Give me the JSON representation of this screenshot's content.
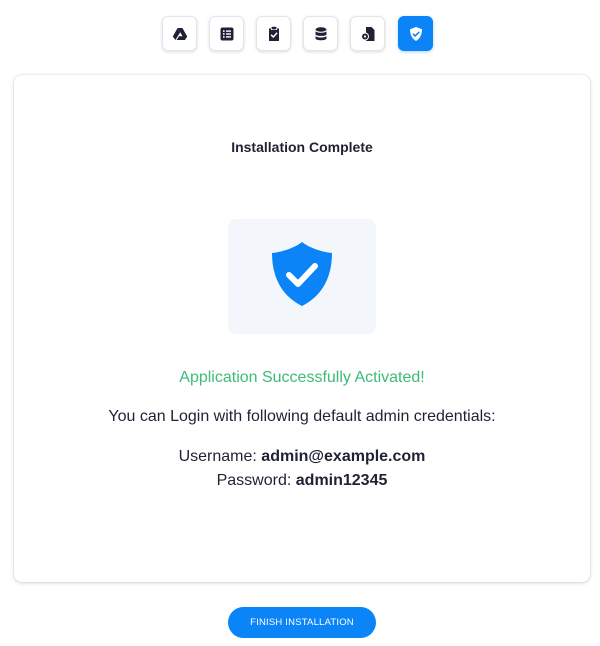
{
  "steps": [
    {
      "icon": "drive-icon",
      "active": false
    },
    {
      "icon": "list-icon",
      "active": false
    },
    {
      "icon": "file-check-icon",
      "active": false
    },
    {
      "icon": "database-icon",
      "active": false
    },
    {
      "icon": "file-settings-icon",
      "active": false
    },
    {
      "icon": "shield-check-icon",
      "active": true
    }
  ],
  "card": {
    "title": "Installation Complete",
    "shield_icon": "shield-check-icon",
    "success_message": "Application Successfully Activated!",
    "login_text": "You can Login with following default admin credentials:",
    "username_label": "Username:",
    "username_value": "admin@example.com",
    "password_label": "Password:",
    "password_value": "admin12345"
  },
  "finish_button_label": "FINISH INSTALLATION",
  "colors": {
    "accent": "#0b84f7",
    "success": "#3dbb79",
    "text": "#1f2233",
    "shield_bg": "#f3f7fc"
  }
}
